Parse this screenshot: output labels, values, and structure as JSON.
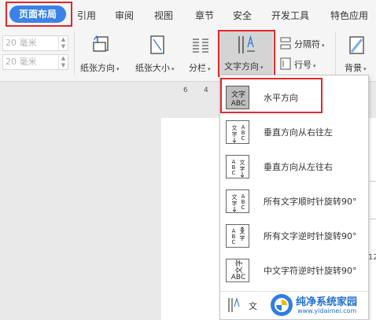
{
  "tabs": {
    "active": "页面布局",
    "items": [
      "引用",
      "审阅",
      "视图",
      "章节",
      "安全",
      "开发工具",
      "特色应用"
    ]
  },
  "ribbon": {
    "spin_top": "20 毫米",
    "spin_bottom": "20 毫米",
    "orientation_label": "纸张方向",
    "size_label": "纸张大小",
    "columns_label": "分栏",
    "text_direction_label": "文字方向",
    "separator_label": "分隔符",
    "line_number_label": "行号",
    "background_label": "背景"
  },
  "ruler": {
    "n6": "6",
    "n4": "4"
  },
  "menu": {
    "items": [
      {
        "label": "水平方向",
        "icon": "horizontal-text-icon",
        "selected": true
      },
      {
        "label": "垂直方向从右往左",
        "icon": "vertical-rtl-icon"
      },
      {
        "label": "垂直方向从左往右",
        "icon": "vertical-ltr-icon"
      },
      {
        "label": "所有文字顺时针旋转90°",
        "icon": "rotate-cw-icon"
      },
      {
        "label": "所有文字逆时针旋转90°",
        "icon": "rotate-ccw-icon"
      },
      {
        "label": "中文字符逆时针旋转90°",
        "icon": "cjk-rotate-ccw-icon"
      }
    ],
    "footer_label": "文"
  },
  "side_value": "12",
  "watermark": {
    "name": "纯净系统家园",
    "url": "www.yidaimei.com"
  },
  "colors": {
    "accent": "#3a82e8",
    "highlight_border": "#e0282c",
    "menu_selected": "#bdbdbd"
  }
}
